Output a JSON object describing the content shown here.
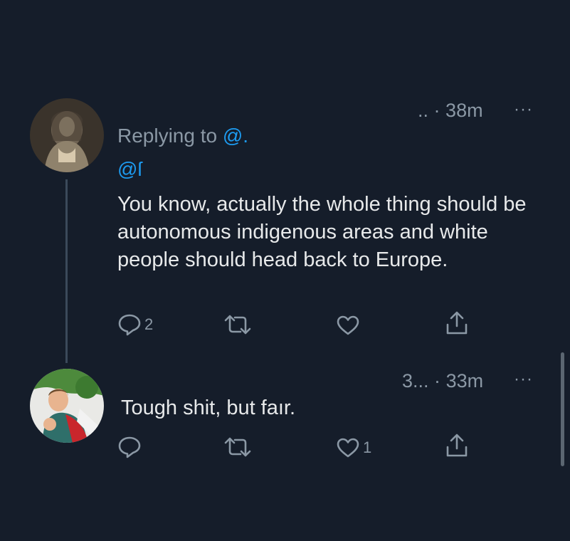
{
  "tweets": [
    {
      "author_display": "..",
      "separator": "·",
      "time": "38m",
      "more": "···",
      "replying_prefix": "Replying to",
      "replying_handle": "@.",
      "mention": "@ſ",
      "text": "You know, actually the whole thing should be autonomous indigenous areas and white people should head back to Europe.",
      "actions": {
        "reply_icon": "reply-icon",
        "reply_count": "2",
        "retweet_icon": "retweet-icon",
        "like_icon": "heart-icon",
        "share_icon": "share-icon"
      }
    },
    {
      "author_display": "3...",
      "separator": "·",
      "time": "33m",
      "more": "···",
      "text": "Tough shit, but faır.",
      "actions": {
        "reply_icon": "reply-icon",
        "retweet_icon": "retweet-icon",
        "like_icon": "heart-icon",
        "like_count": "1",
        "share_icon": "share-icon"
      }
    }
  ],
  "colors": {
    "background": "#151d2a",
    "text": "#e7e9ea",
    "muted": "#8b98a5",
    "link": "#1d9bf0"
  }
}
